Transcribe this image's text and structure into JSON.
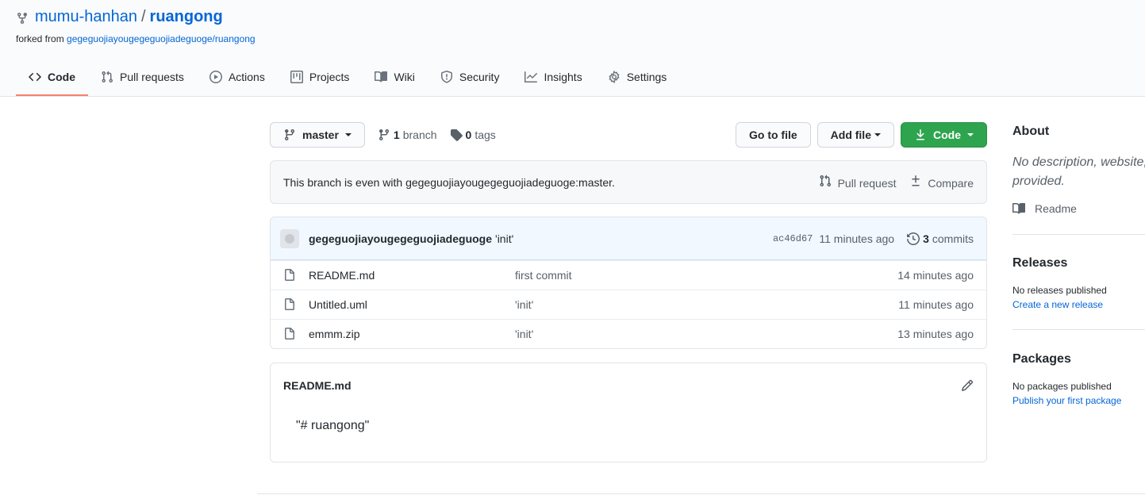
{
  "repo": {
    "owner": "mumu-hanhan",
    "separator": "/",
    "name": "ruangong",
    "forked_prefix": "forked from",
    "forked_from": "gegeguojiayougegeguojiadeguoge/ruangong"
  },
  "tabs": [
    {
      "label": "Code",
      "icon": "code-icon",
      "selected": true
    },
    {
      "label": "Pull requests",
      "icon": "pull-request-icon"
    },
    {
      "label": "Actions",
      "icon": "play-icon"
    },
    {
      "label": "Projects",
      "icon": "project-icon"
    },
    {
      "label": "Wiki",
      "icon": "book-icon"
    },
    {
      "label": "Security",
      "icon": "shield-icon"
    },
    {
      "label": "Insights",
      "icon": "graph-icon"
    },
    {
      "label": "Settings",
      "icon": "gear-icon"
    }
  ],
  "toolbar": {
    "branch_name": "master",
    "branch_count": "1",
    "branch_label": "branch",
    "tag_count": "0",
    "tag_label": "tags",
    "goto_file": "Go to file",
    "add_file": "Add file",
    "code": "Code"
  },
  "branch_status": {
    "text": "This branch is even with gegeguojiayougegeguojiadeguoge:master.",
    "pull_request": "Pull request",
    "compare": "Compare"
  },
  "commit": {
    "author": "gegeguojiayougegeguojiadeguoge",
    "message": "'init'",
    "sha": "ac46d67",
    "age": "11 minutes ago",
    "count": "3",
    "count_label": "commits"
  },
  "files": [
    {
      "name": "README.md",
      "message": "first commit",
      "age": "14 minutes ago"
    },
    {
      "name": "Untitled.uml",
      "message": "'init'",
      "age": "11 minutes ago"
    },
    {
      "name": "emmm.zip",
      "message": "'init'",
      "age": "13 minutes ago"
    }
  ],
  "readme": {
    "title": "README.md",
    "content": "\"# ruangong\""
  },
  "sidebar": {
    "about_title": "About",
    "about_desc_1": "No description, website,",
    "about_desc_2": "provided.",
    "readme_label": "Readme",
    "releases_title": "Releases",
    "releases_text": "No releases published",
    "releases_link": "Create a new release",
    "packages_title": "Packages",
    "packages_text": "No packages published",
    "packages_link": "Publish your first package"
  },
  "colors": {
    "accent_link": "#0366d6",
    "selected_tab_underline": "#f9826c",
    "green_button": "#2ea44f"
  }
}
